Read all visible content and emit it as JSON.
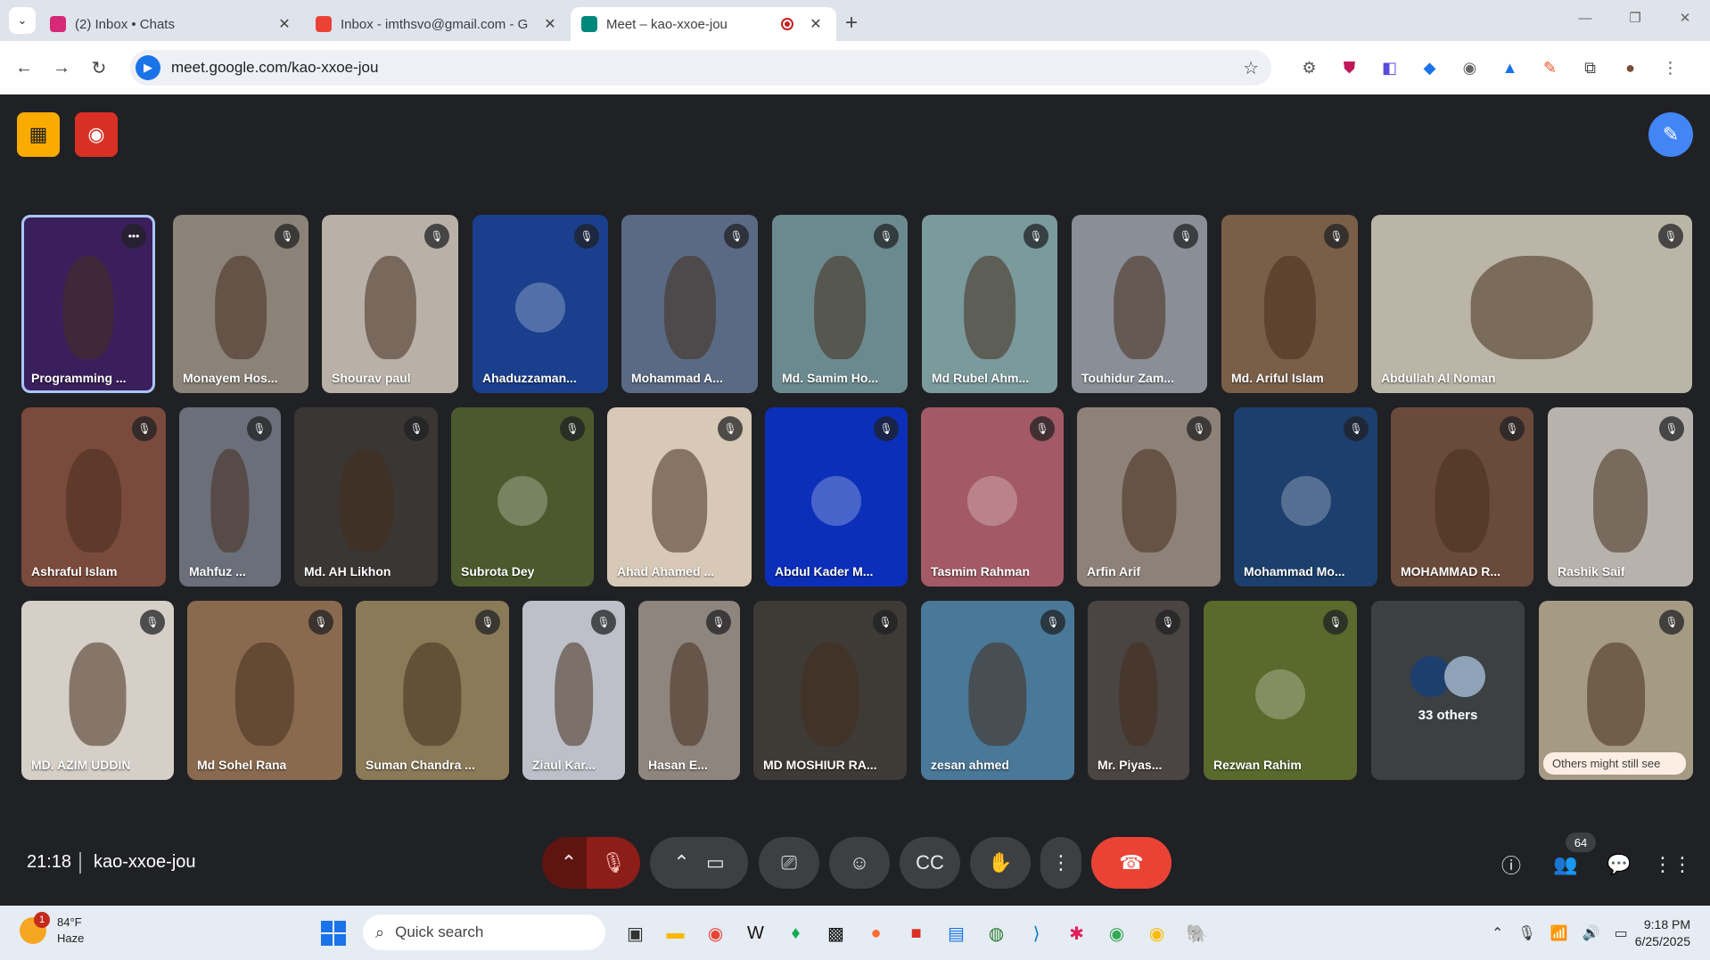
{
  "browser": {
    "tabs": [
      {
        "title": "(2) Inbox • Chats",
        "favicon_color": "#d62976"
      },
      {
        "title": "Inbox - imthsvo@gmail.com - G",
        "favicon_color": "#ea4335"
      },
      {
        "title": "Meet – kao-xxoe-jou",
        "favicon_color": "#00897b",
        "active": true
      }
    ],
    "url": "meet.google.com/kao-xxoe-jou"
  },
  "meet": {
    "meeting_code": "kao-xxoe-jou",
    "time": "21:18",
    "participant_count": "64",
    "participants": [
      {
        "name": "Programming ...",
        "bg": "#3b1f5c",
        "speaking": true
      },
      {
        "name": "Monayem Hos...",
        "bg": "#8b8278"
      },
      {
        "name": "Shourav paul",
        "bg": "#b9b1a8"
      },
      {
        "name": "Ahaduzzaman...",
        "bg": "#1a3f8c",
        "avatar": true
      },
      {
        "name": "Mohammad A...",
        "bg": "#5a6a84"
      },
      {
        "name": "Md. Samim Ho...",
        "bg": "#6b8a8f"
      },
      {
        "name": "Md Rubel Ahm...",
        "bg": "#7a9a9c"
      },
      {
        "name": "Touhidur Zam...",
        "bg": "#8a8e96"
      },
      {
        "name": "Md. Ariful Islam",
        "bg": "#7a5f48"
      },
      {
        "name": "Abdullah Al Noman",
        "bg": "#bab5a6"
      },
      {
        "name": "Ashraful Islam",
        "bg": "#7a4a3c"
      },
      {
        "name": "Mahfuz ...",
        "bg": "#6b6f7a"
      },
      {
        "name": "Md. AH Likhon",
        "bg": "#3a3634"
      },
      {
        "name": "Subrota Dey",
        "bg": "#4a5a2c",
        "avatar": true
      },
      {
        "name": "Ahad Ahamed ...",
        "bg": "#d7c9b5"
      },
      {
        "name": "Abdul Kader M...",
        "bg": "#0b2fb8",
        "avatar": true
      },
      {
        "name": "Tasmim Rahman",
        "bg": "#a35a66",
        "avatar": true
      },
      {
        "name": "Arfin Arif",
        "bg": "#8e8278"
      },
      {
        "name": "Mohammad Mo...",
        "bg": "#1c3f6e",
        "avatar": true
      },
      {
        "name": "MOHAMMAD R...",
        "bg": "#6a4a3a"
      },
      {
        "name": "Rashik Saif",
        "bg": "#b7b3ac"
      },
      {
        "name": "MD. AZIM UDDIN",
        "bg": "#d5cfc8"
      },
      {
        "name": "Md Sohel Rana",
        "bg": "#8a6a4e"
      },
      {
        "name": "Suman Chandra ...",
        "bg": "#8a7a58"
      },
      {
        "name": "Ziaul Kar...",
        "bg": "#bdc0c8"
      },
      {
        "name": "Hasan E...",
        "bg": "#8e857e"
      },
      {
        "name": "MD MOSHIUR RA...",
        "bg": "#3e3a36"
      },
      {
        "name": "zesan ahmed",
        "bg": "#4a7898"
      },
      {
        "name": "Mr. Piyas...",
        "bg": "#4a4442"
      },
      {
        "name": "Rezwan Rahim",
        "bg": "#5a6a2c",
        "avatar": true
      },
      {
        "name": "33 others",
        "bg": "#3c4043",
        "others": true
      },
      {
        "name": "Others might still see",
        "bg": "#a59a84",
        "pill": true
      }
    ]
  },
  "taskbar": {
    "temperature": "84°F",
    "weather": "Haze",
    "weather_badge": "1",
    "search_placeholder": "Quick search",
    "time": "9:18 PM",
    "date": "6/25/2025"
  }
}
